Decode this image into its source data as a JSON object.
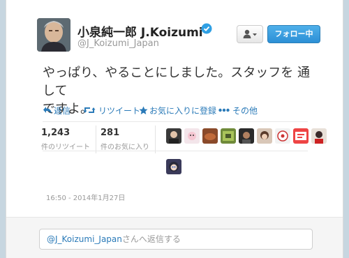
{
  "user": {
    "display_name": "小泉純一郎 J.Koizumi",
    "handle": "@J_Koizumi_Japan",
    "follow_label": "フォロー中"
  },
  "tweet": {
    "text_line1": "やっぱり、やることにしました。スタッフを 通して",
    "text_line2": "ですよ。",
    "timestamp": "16:50 - 2014年1月27日"
  },
  "actions": {
    "reply": "返信",
    "retweet": "リツイート",
    "favorite": "お気に入りに登録",
    "more": "その他"
  },
  "stats": {
    "retweets_count": "1,243",
    "retweets_label": "件のリツイート",
    "favorites_count": "281",
    "favorites_label": "件のお気に入り"
  },
  "reply": {
    "handle": "@J_Koizumi_Japan",
    "suffix": "さんへ返信する"
  },
  "colors": {
    "link": "#2a7ab8",
    "follow_button": "#2c8fd6",
    "verified": "#2fa0e4",
    "background": "#c7d6e0"
  }
}
